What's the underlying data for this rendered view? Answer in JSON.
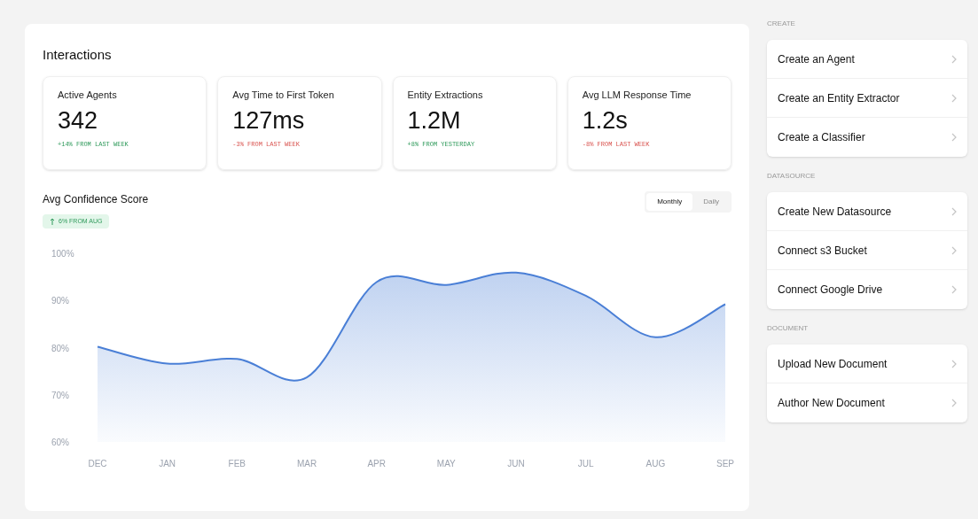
{
  "main": {
    "title": "Interactions",
    "stats": [
      {
        "label": "Active Agents",
        "value": "342",
        "change": "+14% FROM LAST WEEK",
        "kind": "up"
      },
      {
        "label": "Avg Time to First Token",
        "value": "127ms",
        "change": "-3% FROM LAST WEEK",
        "kind": "down"
      },
      {
        "label": "Entity Extractions",
        "value": "1.2M",
        "change": "+8% FROM YESTERDAY",
        "kind": "up"
      },
      {
        "label": "Avg LLM Response Time",
        "value": "1.2s",
        "change": "-8% FROM LAST WEEK",
        "kind": "down"
      }
    ],
    "chart_title": "Avg Confidence Score",
    "badge": {
      "text": "6% FROM AUG",
      "kind": "up"
    },
    "period_tabs": [
      {
        "label": "Monthly",
        "selected": true
      },
      {
        "label": "Daily",
        "selected": false
      }
    ],
    "chart_data": {
      "type": "area",
      "categories": [
        "DEC",
        "JAN",
        "FEB",
        "MAR",
        "APR",
        "MAY",
        "JUN",
        "JUL",
        "AUG",
        "SEP"
      ],
      "series": [
        {
          "color": "#4a7fd6",
          "values": [
            80.2,
            76.6,
            77.6,
            73.7,
            93.9,
            93.3,
            95.9,
            91,
            82.2,
            89.2
          ]
        }
      ],
      "ylim": [
        60,
        100
      ],
      "yticks": [
        {
          "value": 100,
          "label": "100%"
        },
        {
          "value": 90,
          "label": "90%"
        },
        {
          "value": 80,
          "label": "80%"
        },
        {
          "value": 70,
          "label": "70%"
        },
        {
          "value": 60,
          "label": "60%"
        }
      ]
    }
  },
  "sidebar": [
    {
      "heading": "CREATE",
      "items": [
        "Create an Agent",
        "Create an Entity Extractor",
        "Create a Classifier"
      ]
    },
    {
      "heading": "DATASOURCE",
      "items": [
        "Create New Datasource",
        "Connect s3 Bucket",
        "Connect Google Drive"
      ]
    },
    {
      "heading": "DOCUMENT",
      "items": [
        "Upload New Document",
        "Author New Document"
      ]
    }
  ]
}
